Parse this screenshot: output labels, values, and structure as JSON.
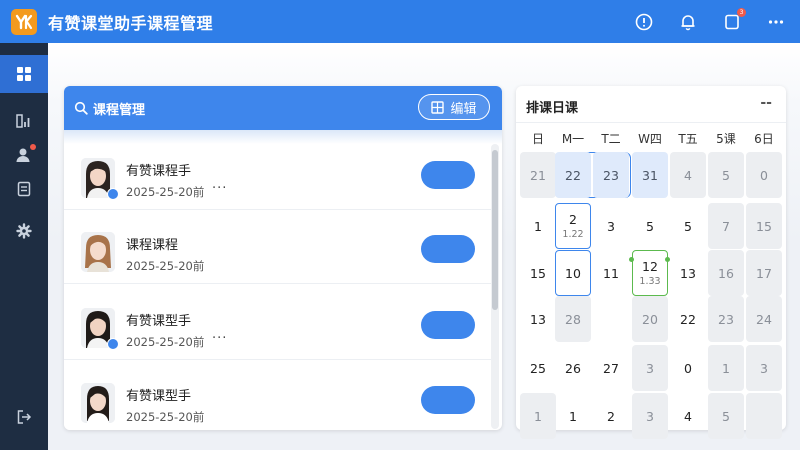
{
  "app": {
    "title": "有赞课堂助手课程管理",
    "logo_text": "YK",
    "brand_color": "#2f7ee8",
    "logo_color": "#f39a1e"
  },
  "top_actions": [
    {
      "name": "info-icon"
    },
    {
      "name": "bell-icon"
    },
    {
      "name": "notes-icon",
      "badge": "3"
    },
    {
      "name": "more-icon"
    }
  ],
  "sidebar": {
    "items": [
      {
        "name": "dashboard-icon",
        "active": true
      },
      {
        "name": "stats-icon",
        "active": false
      },
      {
        "name": "user-icon",
        "active": false,
        "dot": true
      },
      {
        "name": "document-icon",
        "active": false
      },
      {
        "name": "gear-icon",
        "active": false
      },
      {
        "name": "logout-icon",
        "active": false
      }
    ]
  },
  "course_panel": {
    "title": "课程管理",
    "edit_label": "编辑",
    "rows": [
      {
        "name": "有赞课程手",
        "date": "2025-25-20前",
        "more": "···",
        "verified": true
      },
      {
        "name": "课程课程",
        "date": "2025-25-20前",
        "more": "",
        "verified": false
      },
      {
        "name": "有赞课型手",
        "date": "2025-25-20前",
        "more": "···",
        "verified": true
      },
      {
        "name": "有赞课型手",
        "date": "2025-25-20前",
        "more": "",
        "verified": false
      }
    ]
  },
  "calendar": {
    "title": "排课日课",
    "menu": "--",
    "weekdays": [
      "日",
      "M一",
      "T二",
      "W四",
      "T五",
      "5课",
      "6日"
    ],
    "weeks": [
      [
        {
          "d": "21",
          "s": "grey"
        },
        {
          "d": "22",
          "s": "light"
        },
        {
          "d": "23",
          "s": "light"
        },
        {
          "d": "31",
          "s": "light"
        },
        {
          "d": "4",
          "s": "grey"
        },
        {
          "d": "5",
          "s": "grey"
        },
        {
          "d": "0",
          "s": "grey"
        }
      ],
      [
        {
          "d": "1",
          "s": ""
        },
        {
          "d": "2",
          "s": "blue",
          "sub": "1.22"
        },
        {
          "d": "3",
          "s": ""
        },
        {
          "d": "5",
          "s": ""
        },
        {
          "d": "5",
          "s": ""
        },
        {
          "d": "7",
          "s": "grey"
        },
        {
          "d": "15",
          "s": "grey"
        }
      ],
      [
        {
          "d": "15",
          "s": ""
        },
        {
          "d": "10",
          "s": "blue"
        },
        {
          "d": "11",
          "s": ""
        },
        {
          "d": "12",
          "s": "green",
          "sub": "1.33"
        },
        {
          "d": "13",
          "s": ""
        },
        {
          "d": "16",
          "s": "grey"
        },
        {
          "d": "17",
          "s": "grey"
        }
      ],
      [
        {
          "d": "13",
          "s": ""
        },
        {
          "d": "28",
          "s": "grey"
        },
        {
          "d": "",
          "s": ""
        },
        {
          "d": "20",
          "s": "grey"
        },
        {
          "d": "22",
          "s": ""
        },
        {
          "d": "23",
          "s": "grey"
        },
        {
          "d": "24",
          "s": "grey"
        }
      ],
      [
        {
          "d": "25",
          "s": ""
        },
        {
          "d": "26",
          "s": ""
        },
        {
          "d": "27",
          "s": ""
        },
        {
          "d": "3",
          "s": "grey"
        },
        {
          "d": "0",
          "s": ""
        },
        {
          "d": "1",
          "s": "grey"
        },
        {
          "d": "3",
          "s": "grey"
        }
      ],
      [
        {
          "d": "1",
          "s": "grey"
        },
        {
          "d": "1",
          "s": ""
        },
        {
          "d": "2",
          "s": ""
        },
        {
          "d": "3",
          "s": "grey"
        },
        {
          "d": "4",
          "s": ""
        },
        {
          "d": "5",
          "s": "grey"
        },
        {
          "d": "",
          "s": "grey"
        }
      ]
    ]
  }
}
